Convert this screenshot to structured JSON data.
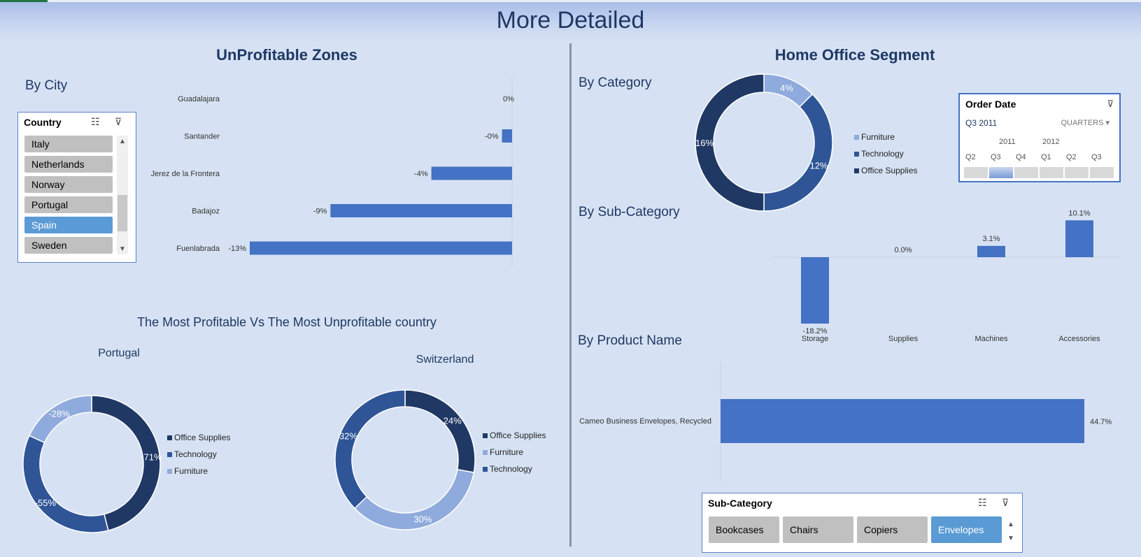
{
  "page": {
    "title": "More Detailed"
  },
  "left": {
    "section_title": "UnProfitable Zones",
    "by_city_label": "By City",
    "country_slicer": {
      "title": "Country",
      "items": [
        {
          "label": "Italy",
          "selected": false
        },
        {
          "label": "Netherlands",
          "selected": false
        },
        {
          "label": "Norway",
          "selected": false
        },
        {
          "label": "Portugal",
          "selected": false
        },
        {
          "label": "Spain",
          "selected": true
        },
        {
          "label": "Sweden",
          "selected": false
        }
      ]
    },
    "comparison_title": "The Most Profitable Vs The Most Unprofitable country",
    "portugal_title": "Portugal",
    "switzerland_title": "Switzerland"
  },
  "right": {
    "section_title": "Home Office Segment",
    "by_category_label": "By Category",
    "by_subcategory_label": "By Sub-Category",
    "by_product_label": "By Product Name",
    "order_date_filter": {
      "title": "Order Date",
      "selected_label": "Q3 2011",
      "granularity": "QUARTERS",
      "years": [
        "2011",
        "2012"
      ],
      "quarters": [
        "Q2",
        "Q3",
        "Q4",
        "Q1",
        "Q2",
        "Q3"
      ],
      "selected_quarter_index": 1
    },
    "subcategory_slicer": {
      "title": "Sub-Category",
      "items": [
        {
          "label": "Bookcases",
          "selected": false
        },
        {
          "label": "Chairs",
          "selected": false
        },
        {
          "label": "Copiers",
          "selected": false
        },
        {
          "label": "Envelopes",
          "selected": true
        }
      ]
    }
  },
  "colors": {
    "bar": "#4472c4",
    "office_supplies": "#203864",
    "technology": "#2f5597",
    "furniture": "#8faadc",
    "slicer_selected": "#5b9bd5"
  },
  "chart_data": [
    {
      "id": "by_city",
      "type": "bar",
      "orientation": "horizontal",
      "categories": [
        "Guadalajara",
        "Santander",
        "Jerez de la Frontera",
        "Badajoz",
        "Fuenlabrada"
      ],
      "values": [
        0,
        -0.5,
        -4,
        -9,
        -13
      ],
      "data_labels": [
        "0%",
        "-0%",
        "-4%",
        "-9%",
        "-13%"
      ],
      "xlim": [
        -13,
        0
      ]
    },
    {
      "id": "by_category",
      "type": "pie",
      "donut": true,
      "labels": [
        "Furniture",
        "Technology",
        "Office Supplies"
      ],
      "values": [
        4,
        12,
        16
      ],
      "data_labels": [
        "4%",
        "12%",
        "16%"
      ],
      "legend": "right"
    },
    {
      "id": "by_subcategory",
      "type": "bar",
      "categories": [
        "Storage",
        "Supplies",
        "Machines",
        "Accessories"
      ],
      "values": [
        -18.2,
        0.0,
        3.1,
        10.1
      ],
      "data_labels": [
        "-18.2%",
        "0.0%",
        "3.1%",
        "10.1%"
      ]
    },
    {
      "id": "by_product",
      "type": "bar",
      "orientation": "horizontal",
      "categories": [
        "Cameo Business Envelopes, Recycled"
      ],
      "values": [
        44.7
      ],
      "data_labels": [
        "44.7%"
      ]
    },
    {
      "id": "portugal",
      "type": "pie",
      "donut": true,
      "labels": [
        "Office Supplies",
        "Technology",
        "Furniture"
      ],
      "values": [
        71,
        55,
        28
      ],
      "data_labels": [
        "-71%",
        "-55%",
        "-28%"
      ],
      "legend": "right"
    },
    {
      "id": "switzerland",
      "type": "pie",
      "donut": true,
      "labels": [
        "Office Supplies",
        "Furniture",
        "Technology"
      ],
      "values": [
        24,
        30,
        32
      ],
      "data_labels": [
        "24%",
        "30%",
        "32%"
      ],
      "legend": "right"
    }
  ]
}
